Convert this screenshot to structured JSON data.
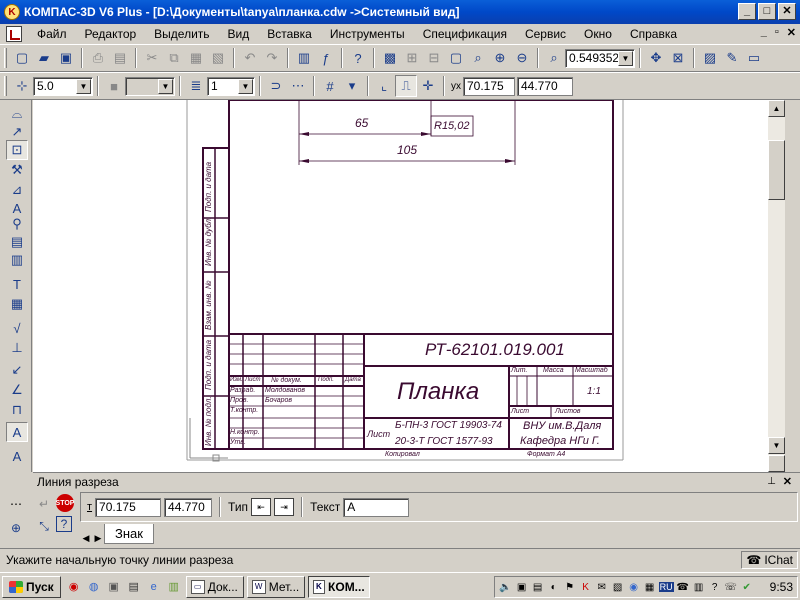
{
  "window": {
    "title": "КОМПАС-3D V6 Plus - [D:\\Документы\\tanya\\планка.cdw ->Системный вид]",
    "app_icon": "kompas-logo-icon",
    "btn_min": "_",
    "btn_max": "□",
    "btn_close": "✕",
    "mdi_min": "_",
    "mdi_restore": "▫",
    "mdi_close": "✕"
  },
  "menu": [
    "Файл",
    "Редактор",
    "Выделить",
    "Вид",
    "Вставка",
    "Инструменты",
    "Спецификация",
    "Сервис",
    "Окно",
    "Справка"
  ],
  "toolbar1": {
    "zoom_value": "0.549352"
  },
  "toolbar2": {
    "step_value": "5.0",
    "layer_value": "1",
    "x_value": "70.175",
    "y_value": "44.770",
    "x_label": "x",
    "y_label": "y"
  },
  "drawing": {
    "dim_65": "65",
    "dim_105": "105",
    "radius": "R15,02",
    "designation": "РТ-62101.019.001",
    "name": "Планка",
    "material_line1": "Б-ПН-3 ГОСТ 19903-74",
    "material_line2": "20-3-Т ГОСТ 1577-93",
    "material_prefix": "Лист",
    "org_line1": "ВНУ им.В.Даля",
    "org_line2": "Кафедра НГи Г.",
    "scale": "1:1",
    "col_lit": "Лит.",
    "col_mass": "Масса",
    "col_scale": "Масштаб",
    "col_sheet": "Лист",
    "col_sheets": "Листов",
    "row_izm": "Изм.",
    "row_list": "Лист",
    "row_doc": "№ докум.",
    "row_sign": "Подп.",
    "row_date": "Дата",
    "role_dev": "Разраб.",
    "role_check": "Пров.",
    "role_tcontr": "Т.контр.",
    "role_ncontr": "Н.контр.",
    "role_utv": "Утв.",
    "name_dev": "Молдованов",
    "name_check": "Бочаров",
    "copied": "Копировал",
    "format": "Формат А4",
    "side1": "Подп. и дата",
    "side2": "Инв. № дубл.",
    "side3": "Взам. инв. №",
    "side4": "Подп. и дата",
    "side5": "Инв. № подл."
  },
  "property_panel": {
    "header": "Линия разреза",
    "t_label": "т",
    "x_value": "70.175",
    "y_value": "44.770",
    "type_label": "Тип",
    "text_label": "Текст",
    "text_value": "А",
    "tab_label": "Знак"
  },
  "status": {
    "hint": "Укажите начальную точку линии разреза",
    "chat": "IChat"
  },
  "taskbar": {
    "start": "Пуск",
    "task1": "Док...",
    "task2": "Мет...",
    "task3": "КОМ...",
    "lang": "RU",
    "clock": "9:53"
  }
}
